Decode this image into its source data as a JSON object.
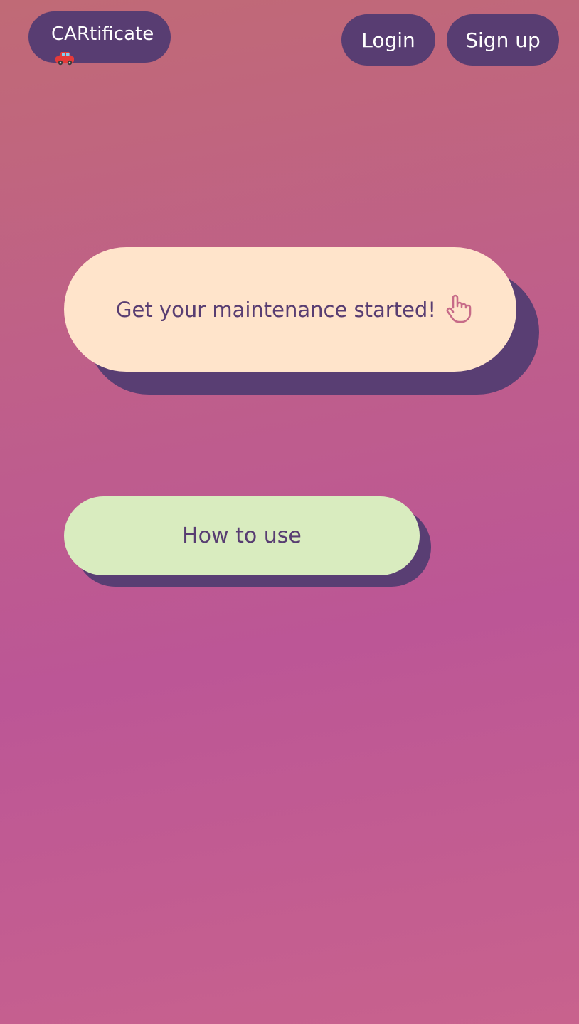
{
  "header": {
    "brand_label": "CARtificate",
    "brand_icon": "car-icon",
    "login_label": "Login",
    "signup_label": "Sign up"
  },
  "main": {
    "cta_label": "Get your maintenance started!",
    "cta_icon": "pointing-hand-icon",
    "how_to_label": "How to use"
  },
  "colors": {
    "nav_pill": "#583d72",
    "cta_bg": "#ffe4cb",
    "how_to_bg": "#d9ecbf",
    "background_top": "#c06a76",
    "background_mid": "#bc5696"
  }
}
